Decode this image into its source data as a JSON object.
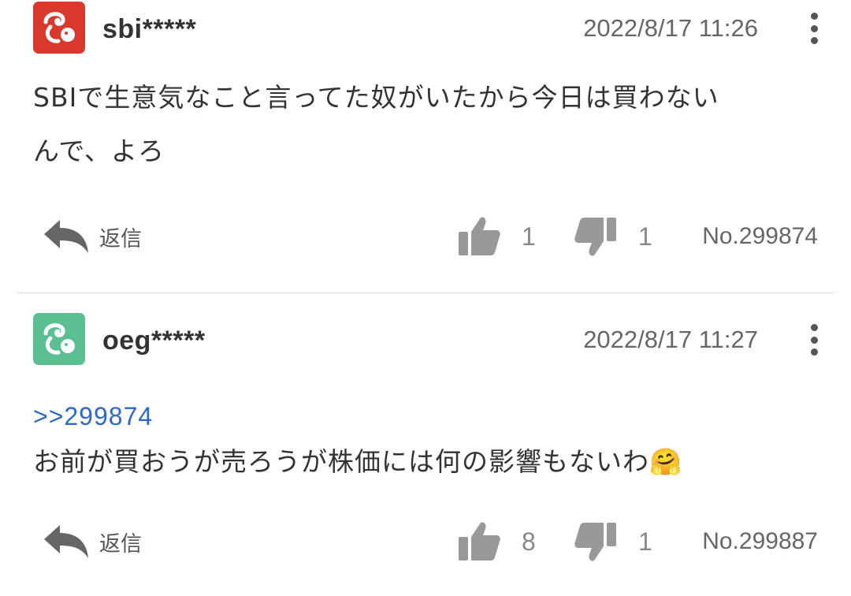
{
  "colors": {
    "avatar_1": "#d9382c",
    "avatar_2": "#5cbf94",
    "link": "#2d69c6"
  },
  "comments": [
    {
      "username": "sbi*****",
      "timestamp": "2022/8/17 11:26",
      "reply_to": "",
      "body_line1": "SBIで生意気なこと言ってた奴がいたから今日は買わない",
      "body_line2": "んで、よろ",
      "reply_label": "返信",
      "likes": "1",
      "dislikes": "1",
      "post_no": "No.299874"
    },
    {
      "username": "oeg*****",
      "timestamp": "2022/8/17 11:27",
      "reply_to": ">>299874",
      "body_line1": "お前が買おうが売ろうが株価には何の影響もないわ",
      "emoji": "🤗",
      "reply_label": "返信",
      "likes": "8",
      "dislikes": "1",
      "post_no": "No.299887"
    }
  ]
}
